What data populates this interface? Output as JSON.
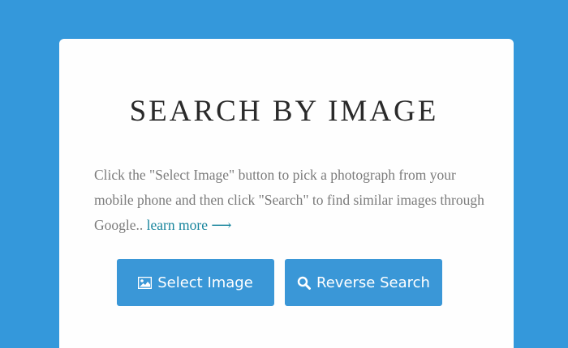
{
  "card": {
    "title": "SEARCH BY IMAGE",
    "description": "Click the \"Select Image\" button to pick a photograph from your mobile phone and then click \"Search\" to find similar images through Google.. ",
    "learn_more": "learn more ⟶"
  },
  "buttons": {
    "select_image": {
      "label": "Select Image",
      "icon": "image-icon"
    },
    "reverse_search": {
      "label": "Reverse Search",
      "icon": "search-icon"
    }
  },
  "colors": {
    "background": "#3498db",
    "card": "#fefefe",
    "button": "#3a97d7",
    "link": "#16849c",
    "title": "#2a2a2a",
    "text": "#7b7b7b"
  }
}
